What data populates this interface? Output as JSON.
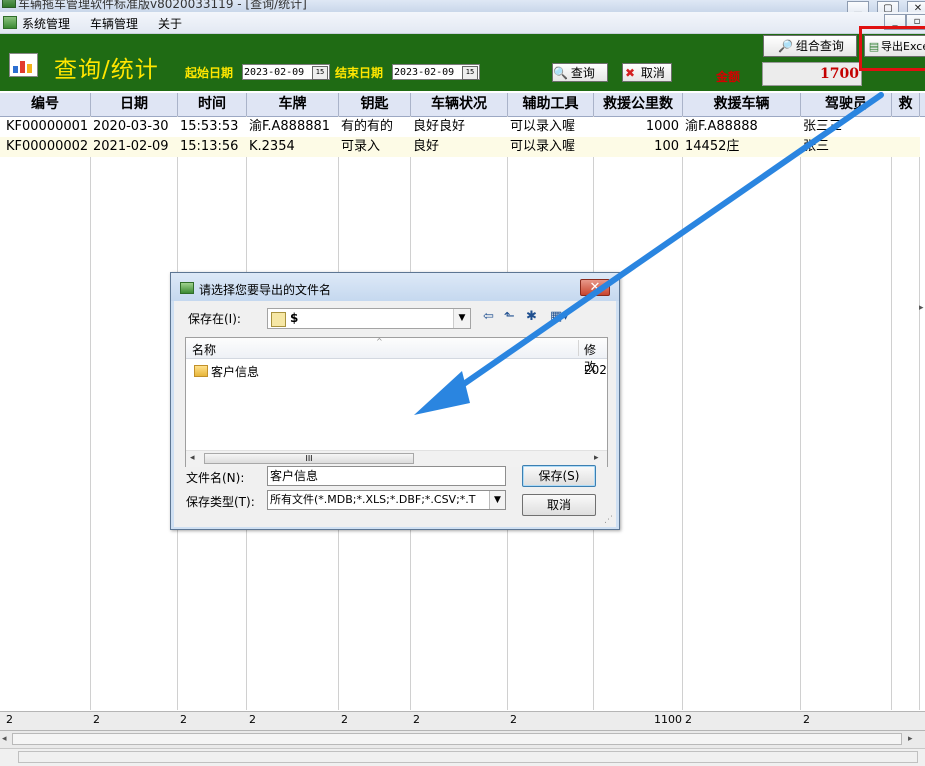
{
  "window": {
    "title": "车辆拖车管理软件标准版v8020033119 - [查询/统计]"
  },
  "menu": {
    "items": [
      "系统管理",
      "车辆管理",
      "关于"
    ]
  },
  "toolbar": {
    "title": "查询/统计",
    "start_label": "起始日期",
    "start_date": "2023-02-09",
    "end_label": "结束日期",
    "end_date": "2023-02-09",
    "calendar_icon": "15",
    "query_label": "查询",
    "cancel_label": "取消",
    "total_label": "金额",
    "total_value": "1700",
    "combo_query_label": "组合查询",
    "export_label": "导出Excel"
  },
  "grid": {
    "columns": [
      "编号",
      "日期",
      "时间",
      "车牌",
      "钥匙",
      "车辆状况",
      "辅助工具",
      "救援公里数",
      "救援车辆",
      "驾驶员",
      "救"
    ],
    "rows": [
      [
        "KF00000001",
        "2020-03-30",
        "15:53:53",
        "渝F.A888881",
        "有的有的",
        "良好良好",
        "可以录入喔",
        "1000",
        "渝F.A88888",
        "张三三",
        ""
      ],
      [
        "KF00000002",
        "2021-02-09",
        "15:13:56",
        "K.2354",
        "可录入",
        "良好",
        "可以录入喔",
        "100",
        "14452庄",
        "张三",
        ""
      ]
    ],
    "footer": [
      "2",
      "2",
      "2",
      "2",
      "2",
      "2",
      "2",
      "1100",
      "2",
      "2",
      ""
    ]
  },
  "dialog": {
    "title": "请选择您要导出的文件名",
    "save_in_label": "保存在(I):",
    "save_in_value": "$",
    "col_name": "名称",
    "col_modified": "修改",
    "files": [
      {
        "name": "客户信息",
        "modified": "202"
      }
    ],
    "filename_label": "文件名(N):",
    "filename_value": "客户信息",
    "filetype_label": "保存类型(T):",
    "filetype_value": "所有文件(*.MDB;*.XLS;*.DBF;*.CSV;*.T",
    "save_button": "保存(S)",
    "cancel_button": "取消"
  },
  "colors": {
    "toolbar_bg": "#1f6b14",
    "toolbar_text": "#ffe600",
    "total_text": "#c40000",
    "highlight_box": "#e01010",
    "arrow": "#2a85e0"
  }
}
